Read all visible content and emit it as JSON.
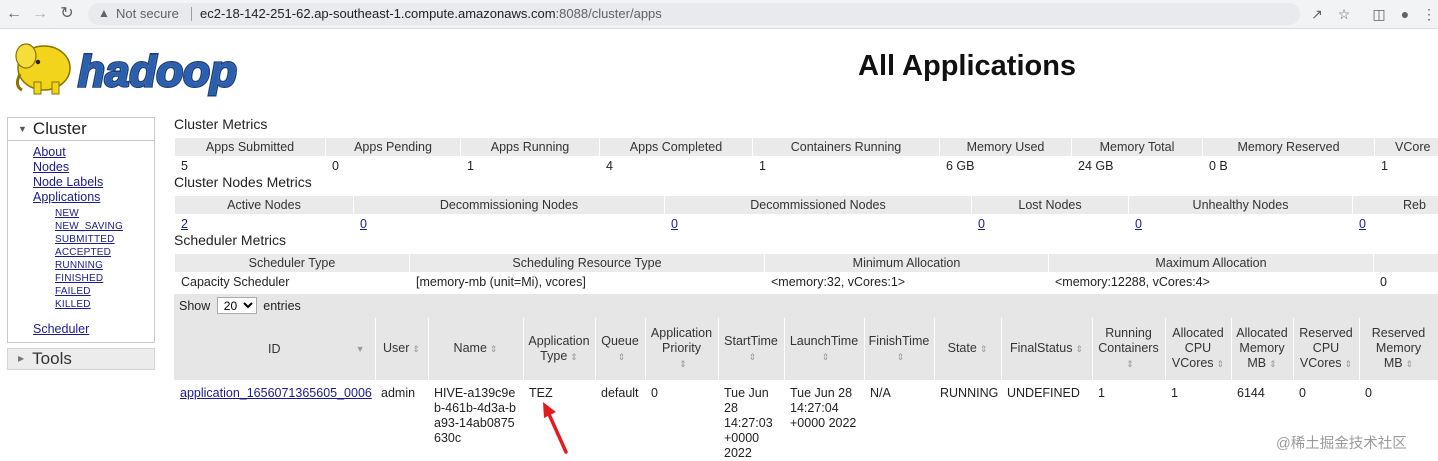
{
  "browser": {
    "not_secure": "Not secure",
    "url_host": "ec2-18-142-251-62.ap-southeast-1.compute.amazonaws.com",
    "url_rest": ":8088/cluster/apps"
  },
  "header": {
    "logo_text": "hadoop",
    "title": "All Applications"
  },
  "sidebar": {
    "cluster_label": "Cluster",
    "links": [
      "About",
      "Nodes",
      "Node Labels",
      "Applications"
    ],
    "app_states": [
      "NEW",
      "NEW_SAVING",
      "SUBMITTED",
      "ACCEPTED",
      "RUNNING",
      "FINISHED",
      "FAILED",
      "KILLED"
    ],
    "scheduler_label": "Scheduler",
    "tools_label": "Tools"
  },
  "cluster_metrics": {
    "title": "Cluster Metrics",
    "headers": [
      "Apps Submitted",
      "Apps Pending",
      "Apps Running",
      "Apps Completed",
      "Containers Running",
      "Memory Used",
      "Memory Total",
      "Memory Reserved",
      "VCore"
    ],
    "values": [
      "5",
      "0",
      "1",
      "4",
      "1",
      "6 GB",
      "24 GB",
      "0 B",
      "1"
    ]
  },
  "nodes_metrics": {
    "title": "Cluster Nodes Metrics",
    "headers": [
      "Active Nodes",
      "Decommissioning Nodes",
      "Decommissioned Nodes",
      "Lost Nodes",
      "Unhealthy Nodes",
      "Reb"
    ],
    "values": [
      "2",
      "0",
      "0",
      "0",
      "0",
      "0"
    ]
  },
  "scheduler_metrics": {
    "title": "Scheduler Metrics",
    "headers": [
      "Scheduler Type",
      "Scheduling Resource Type",
      "Minimum Allocation",
      "Maximum Allocation",
      ""
    ],
    "values": [
      "Capacity Scheduler",
      "[memory-mb (unit=Mi), vcores]",
      "<memory:32, vCores:1>",
      "<memory:12288, vCores:4>",
      "0"
    ]
  },
  "entries": {
    "show_label": "Show",
    "page_size": "20",
    "entries_label": "entries"
  },
  "apps_table": {
    "headers": [
      "ID",
      "User",
      "Name",
      "Application Type",
      "Queue",
      "Application Priority",
      "StartTime",
      "LaunchTime",
      "FinishTime",
      "State",
      "FinalStatus",
      "Running Containers",
      "Allocated CPU VCores",
      "Allocated Memory MB",
      "Reserved CPU VCores",
      "Reserved Memory MB"
    ],
    "row": {
      "id": "application_1656071365605_0006",
      "user": "admin",
      "name": "HIVE-a139c9eb-461b-4d3a-ba93-14ab0875630c",
      "type": "TEZ",
      "queue": "default",
      "priority": "0",
      "start": "Tue Jun 28 14:27:03 +0000 2022",
      "launch": "Tue Jun 28 14:27:04 +0000 2022",
      "finish": "N/A",
      "state": "RUNNING",
      "final_status": "UNDEFINED",
      "running_containers": "1",
      "alloc_vcores": "1",
      "alloc_mem": "6144",
      "res_vcores": "0",
      "res_mem": "0"
    }
  },
  "watermark": "@稀土掘金技术社区",
  "colors": {
    "link": "#1b1b8f",
    "header_bg": "#eaeaea",
    "arrow": "#e11d1d",
    "logo_yellow": "#f2d41c",
    "logo_blue": "#2a5fb0"
  }
}
